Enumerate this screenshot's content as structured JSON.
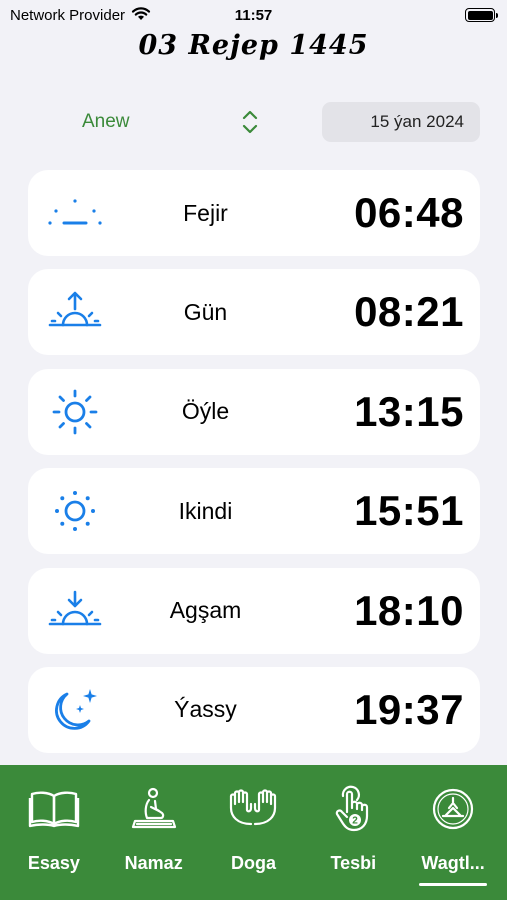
{
  "status_bar": {
    "carrier": "Network Provider",
    "time": "11:57"
  },
  "header": {
    "hijri_date": "03 Rejep 1445"
  },
  "location": {
    "city": "Anew",
    "date": "15 ýan 2024"
  },
  "prayers": [
    {
      "name": "Fejir",
      "time": "06:48",
      "icon": "dawn-icon"
    },
    {
      "name": "Gün",
      "time": "08:21",
      "icon": "sunrise-icon"
    },
    {
      "name": "Öýle",
      "time": "13:15",
      "icon": "sun-icon"
    },
    {
      "name": "Ikindi",
      "time": "15:51",
      "icon": "sun-dotted-icon"
    },
    {
      "name": "Agşam",
      "time": "18:10",
      "icon": "sunset-icon"
    },
    {
      "name": "Ýassy",
      "time": "19:37",
      "icon": "moon-stars-icon"
    }
  ],
  "tabs": [
    {
      "label": "Esasy",
      "icon": "book-icon"
    },
    {
      "label": "Namaz",
      "icon": "prayer-mat-icon"
    },
    {
      "label": "Doga",
      "icon": "praying-hands-icon"
    },
    {
      "label": "Tesbi",
      "icon": "tap-counter-icon"
    },
    {
      "label": "Wagtl...",
      "icon": "alarm-clock-icon",
      "selected": true
    }
  ],
  "colors": {
    "accent_green": "#3b8a3a",
    "icon_blue": "#1a7fe8",
    "background": "#f2f2f7"
  }
}
